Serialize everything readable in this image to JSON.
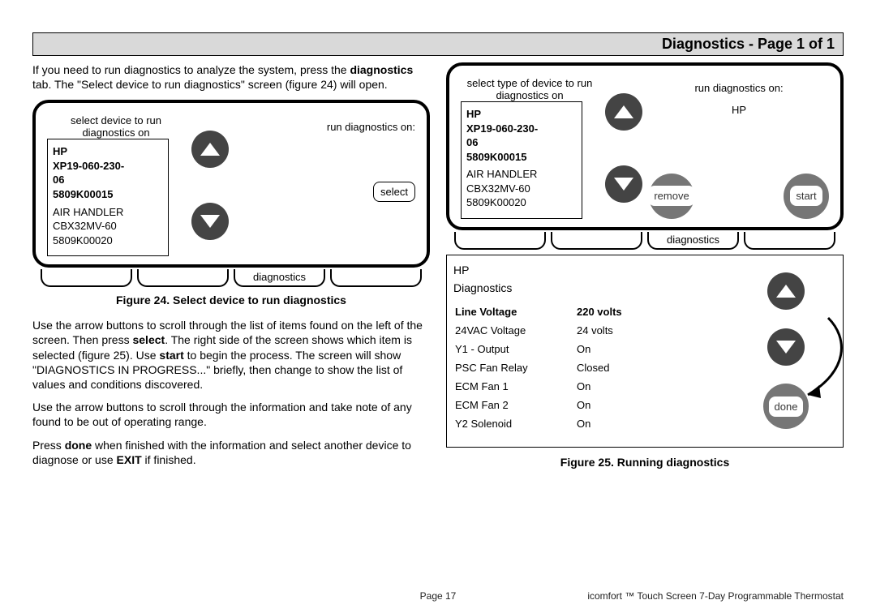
{
  "header": {
    "title": "Diagnostics - Page 1 of 1"
  },
  "left": {
    "intro_a": "If you need to run diagnostics to analyze the system, press the ",
    "intro_b_bold": "diagnostics",
    "intro_c": " tab. The \"Select device to run diagnostics\" screen (figure 24) will open.",
    "screen24": {
      "left_heading": "select device to run diagnostics on",
      "right_heading": "run diagnostics on:",
      "selected": [
        "HP",
        "XP19-060-230-",
        "06",
        "5809K00015"
      ],
      "other": [
        "AIR HANDLER",
        "CBX32MV-60",
        "5809K00020"
      ],
      "select_label": "select",
      "tab_label": "diagnostics"
    },
    "fig24_caption": "Figure 24. Select device to run diagnostics",
    "para2_a": "Use the arrow buttons to scroll through the list of items found on the left of the screen.  Then press ",
    "para2_b_bold": "select",
    "para2_c": ". The right side of the screen shows which item is selected (figure 25). Use ",
    "para2_d_bold": "start",
    "para2_e": " to begin the process. The screen will show \"DIAGNOSTICS IN PROGRESS...\" briefly, then change to show the list of  values and conditions discovered.",
    "para3": "Use the arrow buttons  to scroll through the information and take note of any found to be out of operating range.",
    "para4_a": "Press ",
    "para4_b_bold": "done",
    "para4_c": " when finished with the information and select another device to diagnose or use ",
    "para4_d_bold": "EXIT",
    "para4_e": " if finished."
  },
  "right": {
    "screen25_top": {
      "left_heading": "select type of device to run diagnostics on",
      "right_heading_a": "run diagnostics on:",
      "right_heading_b": "HP",
      "selected": [
        "HP",
        "XP19-060-230-",
        "06",
        "5809K00015"
      ],
      "other": [
        "AIR HANDLER",
        "CBX32MV-60",
        "5809K00020"
      ],
      "remove_label": "remove",
      "start_label": "start",
      "tab_label": "diagnostics"
    },
    "screen25_bottom": {
      "title_a": "HP",
      "title_b": "Diagnostics",
      "rows": [
        {
          "k": "Line Voltage",
          "v": "220 volts",
          "bold": true
        },
        {
          "k": "24VAC Voltage",
          "v": "24 volts"
        },
        {
          "k": "Y1 - Output",
          "v": "On"
        },
        {
          "k": "PSC Fan Relay",
          "v": "Closed"
        },
        {
          "k": "ECM Fan 1",
          "v": "On"
        },
        {
          "k": "ECM Fan 2",
          "v": "On"
        },
        {
          "k": "Y2 Solenoid",
          "v": "On"
        }
      ],
      "done_label": "done"
    },
    "fig25_caption": "Figure 25. Running diagnostics"
  },
  "footer": {
    "page": "Page 17",
    "product": "icomfort ™ Touch Screen 7-Day Programmable Thermostat"
  }
}
